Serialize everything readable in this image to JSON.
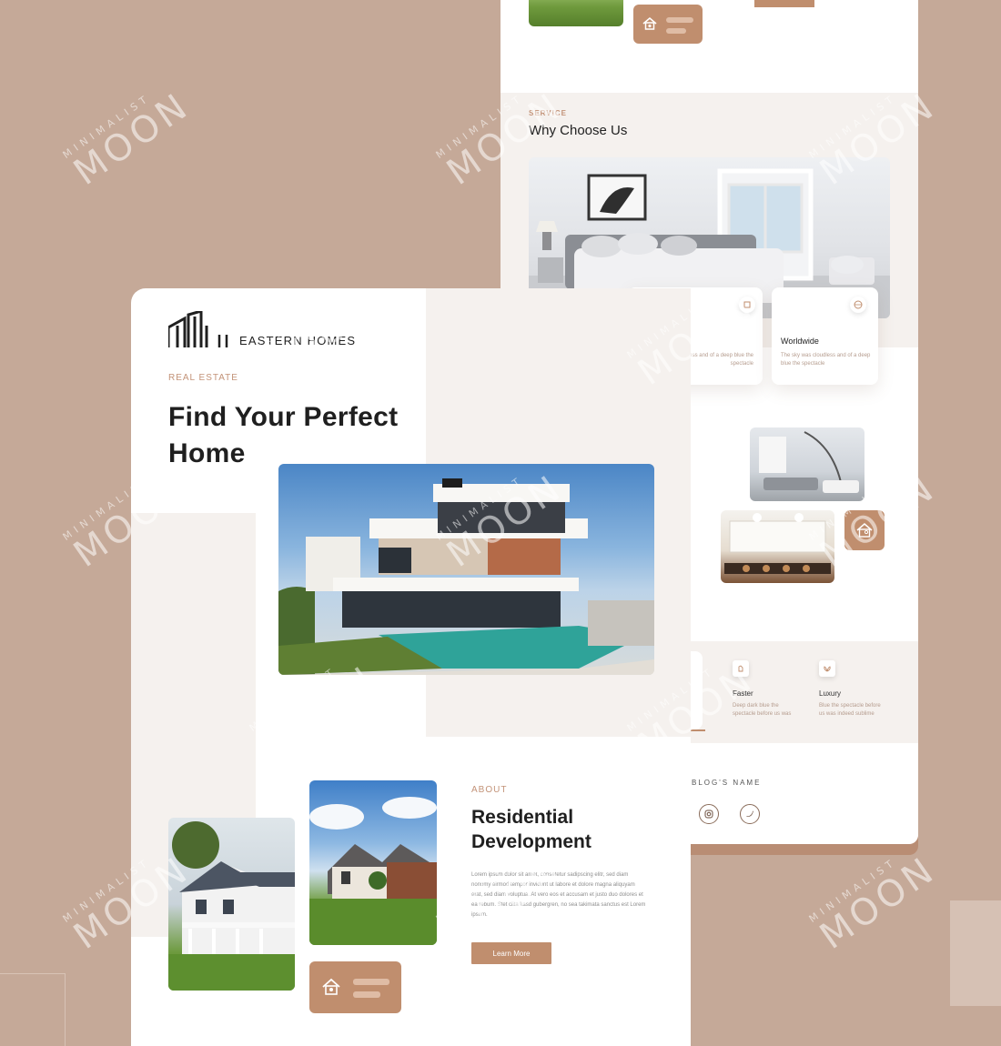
{
  "back_page": {
    "service_label": "SERVICE",
    "why_title": "Why Choose Us",
    "cards": [
      {
        "title": "g",
        "text": "The sky was cloudless and of a deep blue the spectacle",
        "icon": "award-icon"
      },
      {
        "title": "Worldwide",
        "text": "The sky was cloudless and of a deep blue the spectacle",
        "icon": "globe-icon"
      }
    ],
    "features": [
      {
        "title": "Faster",
        "text": "Deep dark blue the spectacle before us was",
        "icon": "hand-icon"
      },
      {
        "title": "Luxury",
        "text": "Blue the spectacle before us was indeed sublime",
        "icon": "lotus-icon"
      }
    ],
    "blog_name": "BLOG'S NAME",
    "social": [
      "instagram-icon",
      "twitter-icon"
    ]
  },
  "front_page": {
    "brand": "EASTERN HOMES",
    "hero_kicker": "REAL ESTATE",
    "hero_title_line1": "Find Your Perfect",
    "hero_title_line2": "Home",
    "about_kicker": "ABOUT",
    "about_title_line1": "Residential",
    "about_title_line2": "Development",
    "about_text": "Lorem ipsum dolor sit amet, consetetur sadipscing elitr, sed diam nonumy eirmod tempor invidunt ut labore et dolore magna aliquyam erat, sed diam voluptua. At vero eos et accusam et justo duo dolores et ea rebum. Stet clita kasd gubergren, no sea takimata sanctus est Lorem ipsum.",
    "cta_label": "Learn More"
  },
  "watermark": {
    "line1": "MINIMALIST",
    "line2": "MOON"
  },
  "colors": {
    "accent": "#c08e6e",
    "background": "#c5a998",
    "panel": "#f5f1ee"
  }
}
